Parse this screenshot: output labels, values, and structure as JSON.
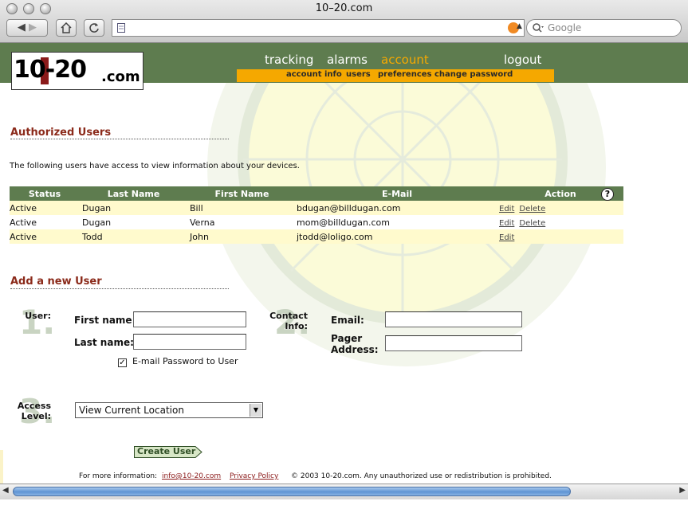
{
  "window": {
    "title": "10–20.com"
  },
  "toolbar": {
    "search_placeholder": "Google"
  },
  "logo": {
    "text": "10-20",
    "suffix": ".com"
  },
  "nav": {
    "main": [
      "tracking",
      "alarms",
      "account",
      "logout"
    ],
    "active": "account",
    "sub": [
      "account info",
      "users",
      "preferences",
      "change password"
    ]
  },
  "authorized": {
    "title": "Authorized Users",
    "intro": "The following users have access to view information about your devices.",
    "columns": [
      "Status",
      "Last Name",
      "First Name",
      "E-Mail",
      "Action"
    ],
    "rows": [
      {
        "status": "Active",
        "last": "Dugan",
        "first": "Bill",
        "email": "bdugan@billdugan.com",
        "actions": [
          "Edit",
          "Delete"
        ]
      },
      {
        "status": "Active",
        "last": "Dugan",
        "first": "Verna",
        "email": "mom@billdugan.com",
        "actions": [
          "Edit",
          "Delete"
        ]
      },
      {
        "status": "Active",
        "last": "Todd",
        "first": "John",
        "email": "jtodd@loligo.com",
        "actions": [
          "Edit"
        ]
      }
    ],
    "help": "?"
  },
  "add_user": {
    "title": "Add a new User",
    "step1": {
      "num": "1.",
      "label": "User:"
    },
    "step2": {
      "num": "2.",
      "label": "Contact Info:"
    },
    "step3": {
      "num": "3.",
      "label": "Access Level:"
    },
    "first_name_label": "First name:",
    "last_name_label": "Last name:",
    "email_label": "Email:",
    "pager_label": "Pager Address:",
    "email_password_label": "E-mail Password to User",
    "email_password_checked": true,
    "access_level_value": "View Current Location",
    "create_button": "Create User"
  },
  "footer": {
    "prefix": "For more information:",
    "email": "info@10-20.com",
    "privacy": "Privacy Policy",
    "copyright": "© 2003 10-20.com. Any unauthorized use or redistribution is prohibited."
  },
  "colors": {
    "header_green": "#5e7c4f",
    "nav_orange": "#f5a800",
    "active_nav": "#f5a800",
    "title_red": "#8b2a1a",
    "row_yellow": "#fffacd"
  }
}
